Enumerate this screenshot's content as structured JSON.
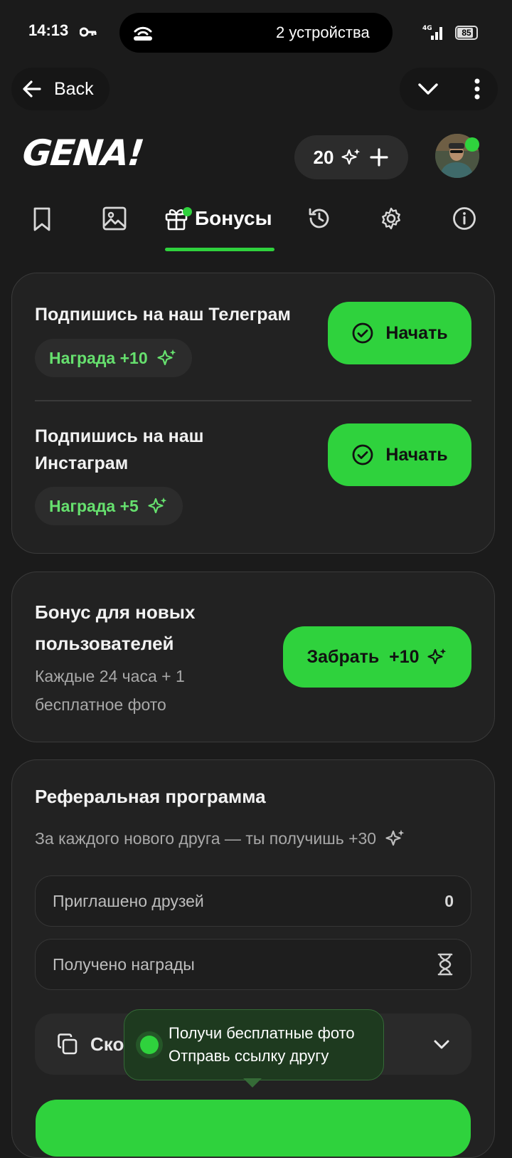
{
  "status_bar": {
    "time": "14:13",
    "pill_text": "2 устройства",
    "network": "4G",
    "battery": "85",
    "battery_level": 0.85
  },
  "nav": {
    "back_label": "Back"
  },
  "header": {
    "logo": "GENA!",
    "credits": "20"
  },
  "tabs": {
    "active_label": "Бонусы",
    "icons": [
      "bookmark-icon",
      "image-icon",
      "gift-icon",
      "history-icon",
      "gear-icon",
      "info-icon"
    ]
  },
  "social_tasks": [
    {
      "title": "Подпишись на наш Телеграм",
      "reward": "Награда +10",
      "button": "Начать"
    },
    {
      "title_line1": "Подпишись на наш",
      "title_line2": "Инстаграм",
      "reward": "Награда +5",
      "button": "Начать"
    }
  ],
  "new_user_bonus": {
    "title_line1": "Бонус для новых",
    "title_line2": "пользователей",
    "desc_line1": "Каждые 24 часа + 1",
    "desc_line2": "бесплатное фото",
    "button": "Забрать  +10"
  },
  "referral": {
    "title": "Реферальная программа",
    "subtitle": "За каждого нового друга — ты получишь +30",
    "invited_label": "Приглашено друзей",
    "invited_value": "0",
    "reward_label": "Получено награды",
    "copy_label": "Скопировать ссылку"
  },
  "tooltip": {
    "line1": "Получи бесплатные фото",
    "line2": "Отправь ссылку другу"
  },
  "colors": {
    "accent": "#2fd23d",
    "reward_text": "#66e06e",
    "background": "#1b1b1b",
    "card": "#222222"
  }
}
